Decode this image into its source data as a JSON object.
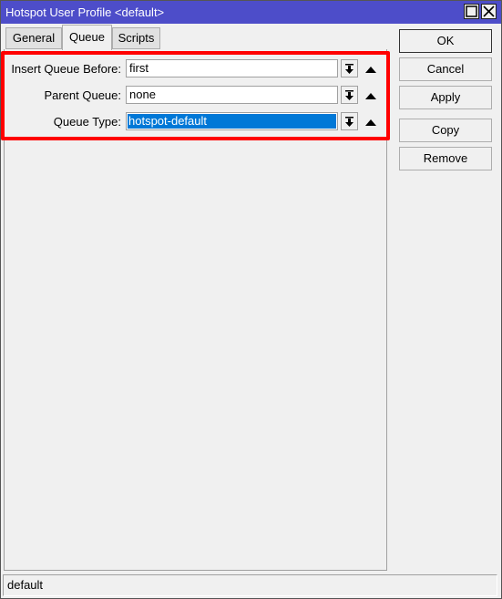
{
  "window": {
    "title": "Hotspot User Profile <default>",
    "maximize_icon": "maximize-icon",
    "close_icon": "close-icon"
  },
  "tabs": [
    {
      "label": "General",
      "active": false
    },
    {
      "label": "Queue",
      "active": true
    },
    {
      "label": "Scripts",
      "active": false
    }
  ],
  "form": {
    "fields": [
      {
        "label": "Insert Queue Before:",
        "value": "first",
        "selected": false
      },
      {
        "label": "Parent Queue:",
        "value": "none",
        "selected": false
      },
      {
        "label": "Queue Type:",
        "value": "hotspot-default",
        "selected": true
      }
    ],
    "dropdown_icon": "dropdown-arrow-icon",
    "collapse_icon": "collapse-up-icon"
  },
  "buttons": {
    "ok": "OK",
    "cancel": "Cancel",
    "apply": "Apply",
    "copy": "Copy",
    "remove": "Remove"
  },
  "status": {
    "text": "default"
  },
  "colors": {
    "titlebar": "#4d4dc9",
    "selection": "#0078d7",
    "highlight_border": "#ff0000"
  }
}
